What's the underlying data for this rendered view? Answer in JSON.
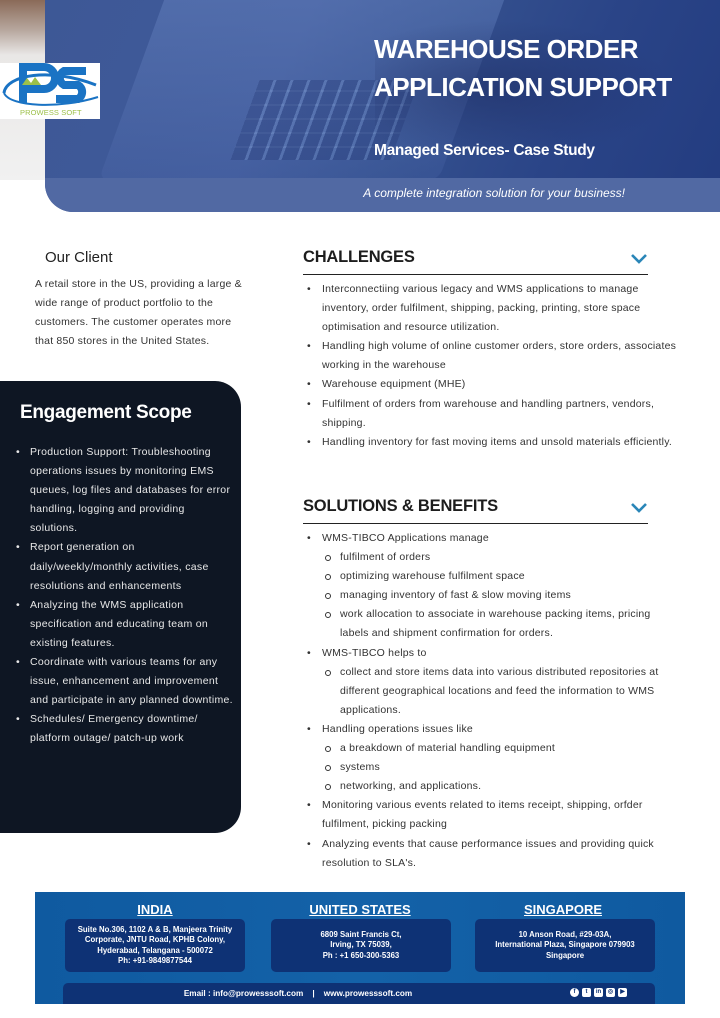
{
  "hero": {
    "title_line1": "WAREHOUSE ORDER",
    "title_line2": "APPLICATION SUPPORT",
    "subtitle": "Managed Services- Case Study",
    "tagline": "A complete integration solution for your business!"
  },
  "logo": {
    "mark": "PS",
    "name": "PROWESS SOFT",
    "colors": {
      "blue": "#1a73c4",
      "green": "#9dc04a"
    }
  },
  "client": {
    "title": "Our Client",
    "body": "A retail store in the US, providing a large & wide range of product portfolio to the customers. The customer operates more that 850 stores in the United States."
  },
  "scope": {
    "title": "Engagement Scope",
    "items": [
      "Production Support: Troubleshooting operations issues by monitoring EMS queues, log files and databases for error handling, logging and providing solutions.",
      "Report generation on daily/weekly/monthly activities, case resolutions and enhancements",
      "Analyzing the WMS application specification and educating team on existing features.",
      "Coordinate with various teams for any issue, enhancement and improvement and participate in any planned downtime.",
      "Schedules/ Emergency downtime/ platform outage/ patch-up work"
    ]
  },
  "challenges": {
    "title": "CHALLENGES",
    "icon": "chevron-down-icon",
    "items": [
      "Interconnectiing various legacy and WMS applications to manage inventory, order fulfilment, shipping, packing, printing, store space optimisation and resource utilization.",
      "Handling high volume of online customer orders, store orders, associates working in the warehouse",
      "Warehouse equipment (MHE)",
      "Fulfilment of orders from warehouse and handling partners, vendors, shipping.",
      "Handling inventory for fast moving items and unsold materials efficiently."
    ]
  },
  "solutions": {
    "title": "SOLUTIONS & BENEFITS",
    "icon": "chevron-down-icon",
    "items": [
      {
        "text": "WMS-TIBCO Applications manage",
        "sub": [
          "fulfilment of orders",
          "optimizing warehouse fulfilment space",
          "managing inventory of fast & slow moving items",
          "work allocation to associate in warehouse packing items, pricing labels and shipment confirmation for orders."
        ]
      },
      {
        "text": "WMS-TIBCO helps to",
        "sub": [
          "collect and store items data into various distributed repositories at different geographical locations and feed the information to WMS applications."
        ]
      },
      {
        "text": "Handling operations issues like",
        "sub": [
          "a breakdown of material handling equipment",
          "systems",
          "networking, and applications."
        ]
      },
      {
        "text": "Monitoring various events related to items receipt, shipping, orfder fulfilment, picking packing",
        "sub": []
      },
      {
        "text": "Analyzing events that cause performance issues and providing quick resolution to SLA's.",
        "sub": []
      }
    ]
  },
  "footer": {
    "offices": [
      {
        "country": "INDIA",
        "lines": [
          "Suite No.306, 1102 A & B, Manjeera Trinity",
          "Corporate, JNTU Road, KPHB Colony,",
          "Hyderabad, Telangana - 500072",
          "Ph: +91-9849877544"
        ]
      },
      {
        "country": "UNITED STATES",
        "lines": [
          "6809 Saint Francis Ct,",
          "Irving, TX 75039,",
          "Ph : +1 650-300-5363"
        ]
      },
      {
        "country": "SINGAPORE",
        "lines": [
          "10 Anson Road, #29-03A,",
          "International Plaza, Singapore 079903",
          "Singapore"
        ]
      }
    ],
    "contact": "Email : info@prowesssoft.com    |    www.prowesssoft.com",
    "social_icons": [
      {
        "name": "facebook-icon",
        "glyph": "f"
      },
      {
        "name": "twitter-icon",
        "glyph": "t"
      },
      {
        "name": "linkedin-icon",
        "glyph": "in"
      },
      {
        "name": "instagram-icon",
        "glyph": "◎"
      },
      {
        "name": "youtube-icon",
        "glyph": "▶"
      }
    ],
    "colors": {
      "band": "#1462a8",
      "box": "#0e3275"
    }
  }
}
